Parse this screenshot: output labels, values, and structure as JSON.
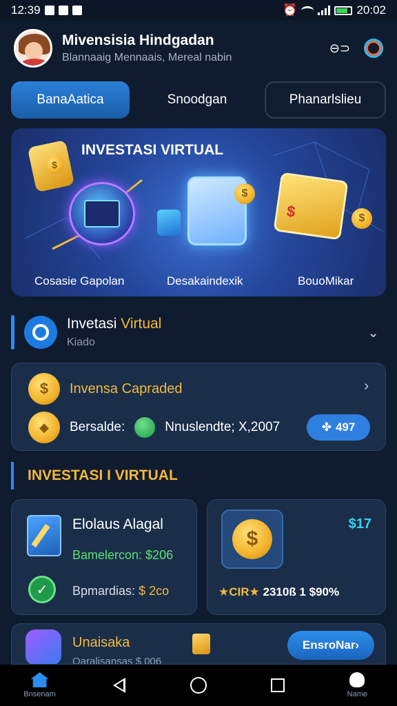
{
  "status_bar": {
    "time": "12:39",
    "right_time": "20:02"
  },
  "header": {
    "title": "Mivensisia Hindgadan",
    "subtitle": "Blannaaig Mennaais, Mereal nabin"
  },
  "tabs": [
    {
      "label": "BanaAatica"
    },
    {
      "label": "Snoodgan"
    },
    {
      "label": "Phanarlslieu"
    }
  ],
  "banner": {
    "title": "INVESTASI VIRTUAL",
    "captions": [
      "Cosasie Gapolan",
      "Desakaindexik",
      "BouoMikar"
    ],
    "coin_symbol": "$",
    "sign_label": "$"
  },
  "section": {
    "title_prefix": "Invetasi",
    "title_highlight": "Virtual",
    "subtitle": "Kiado"
  },
  "invest_card": {
    "label": "Invensa Capraded",
    "coin_symbol": "$",
    "balance_label": "Bersalde:",
    "balance_value": "Nnuslendte; X,2007",
    "pill_value": "497"
  },
  "heading": {
    "text": "INVESTASI I VIRTUAL"
  },
  "card_left": {
    "title": "Elolaus Alagal",
    "line1": "Bamelercon: $206",
    "line2_prefix": "Bpmardias:",
    "line2_value": "$ 2co",
    "check": "✓"
  },
  "card_right": {
    "coin_symbol": "$",
    "price": "$17",
    "stat_prefix": "★CIR★",
    "stat_value": "2310ß 1 $90%"
  },
  "bottom_card": {
    "title": "Unaisaka",
    "subtitle": "Oaralisansas $ 006",
    "cta": "EnsroNar›"
  },
  "nav": {
    "left_label": "Bnsenam",
    "right_label": "Name"
  },
  "colors": {
    "background": "#0f1b2e",
    "accent_blue": "#2d8df0",
    "gold": "#f5b93a",
    "green": "#5ee077"
  }
}
